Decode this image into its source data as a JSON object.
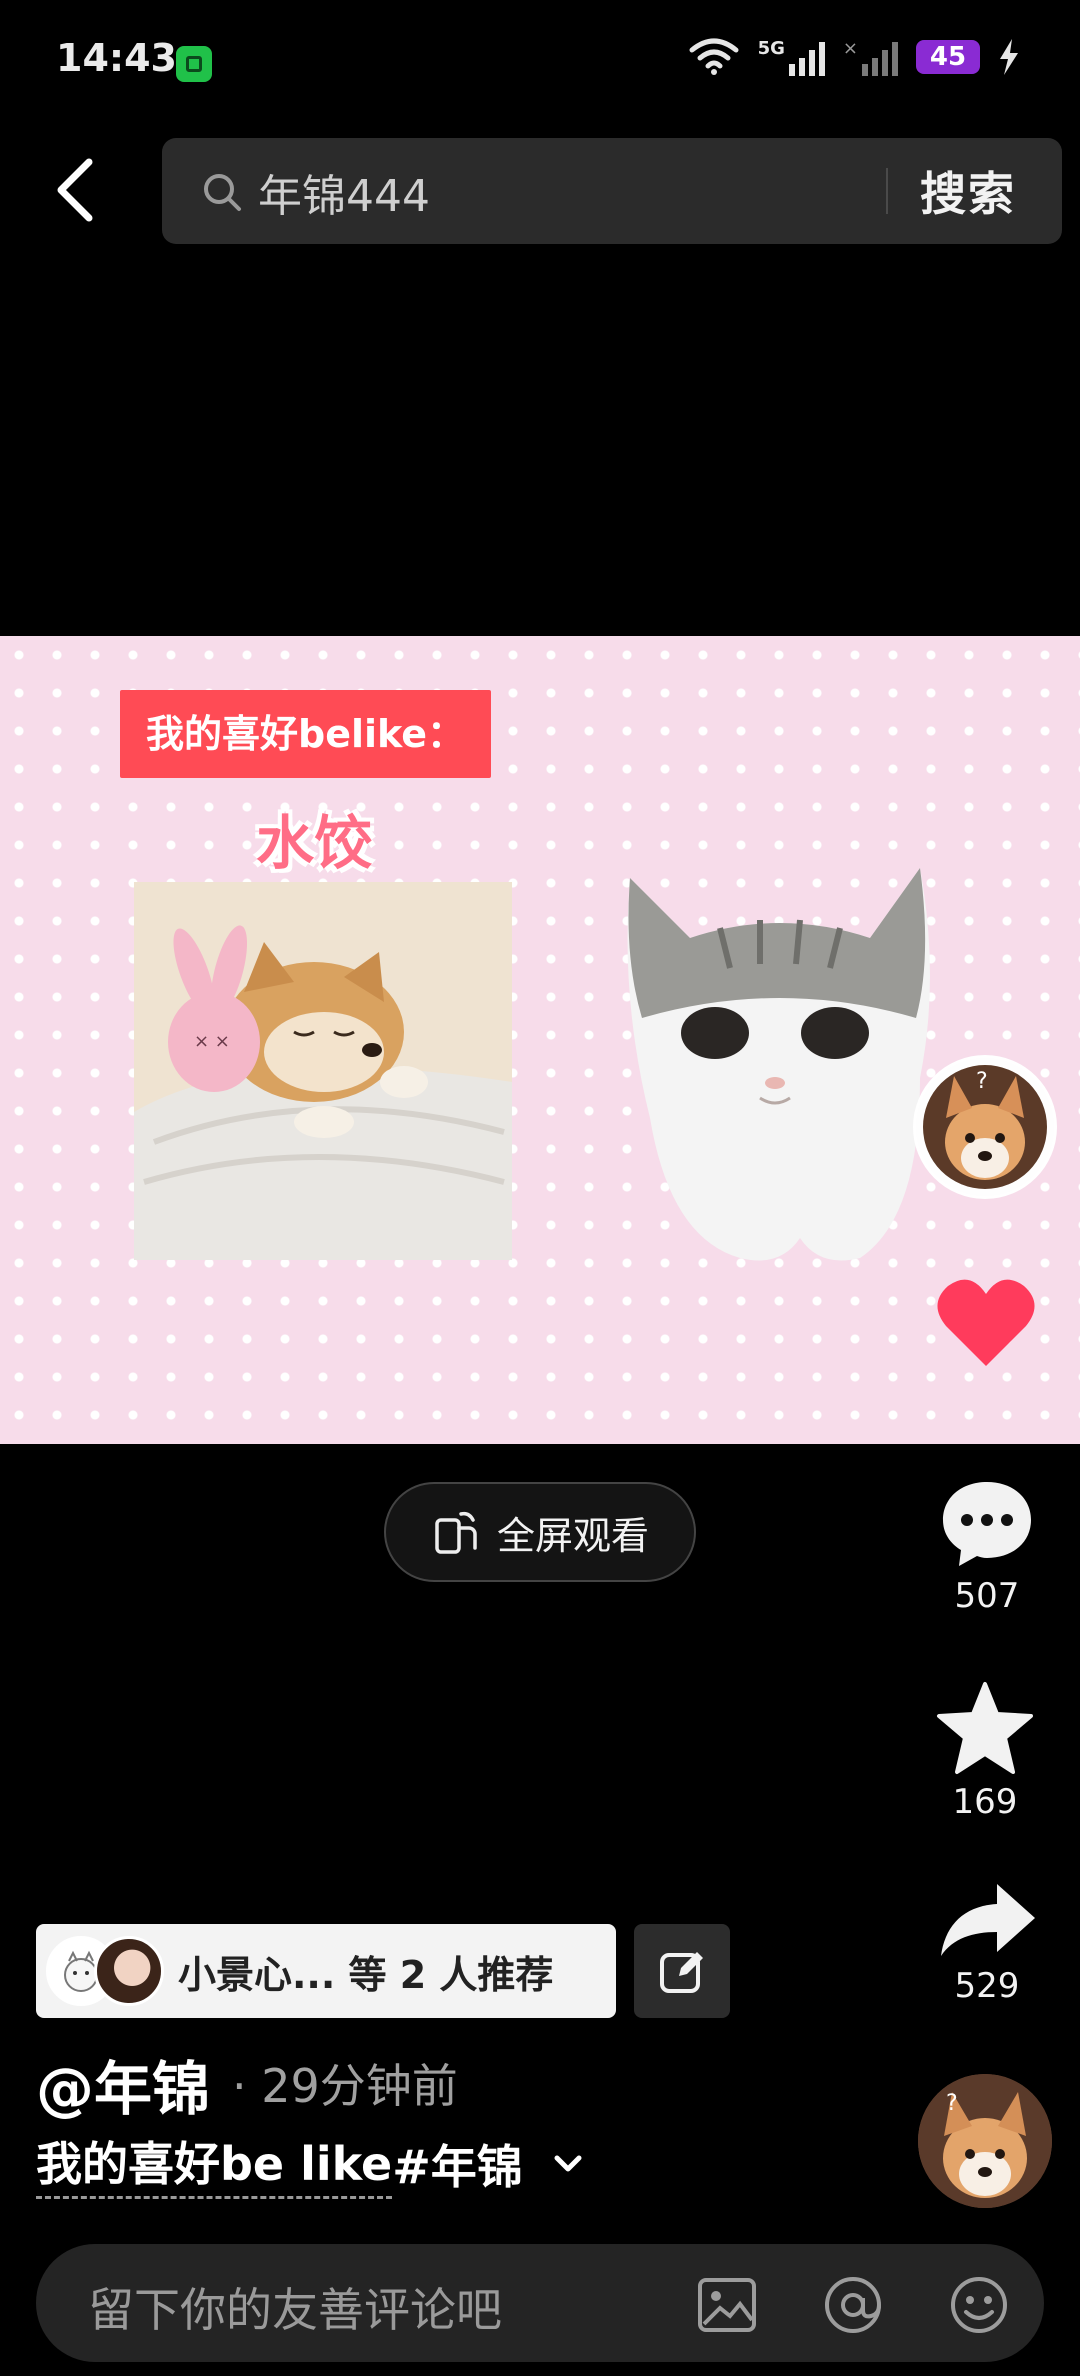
{
  "status_bar": {
    "time": "14:43",
    "network": "5G",
    "battery": "45"
  },
  "search": {
    "query": "年锦444",
    "button_label": "搜索"
  },
  "video": {
    "tag_text": "我的喜好belike：",
    "sub_text": "水饺",
    "fullscreen_label": "全屏观看"
  },
  "actions": {
    "comments": "507",
    "favorites": "169",
    "shares": "529"
  },
  "post": {
    "recommend_text": "小景心... 等 2 人推荐",
    "author": "@年锦",
    "time_ago": "· 29分钟前",
    "description_main": "我的喜好be like",
    "description_tag": "#年锦"
  },
  "comment": {
    "placeholder": "留下你的友善评论吧"
  },
  "colors": {
    "accent_red": "#ff4b55",
    "heart": "#ff3b5c",
    "background": "#000000"
  }
}
